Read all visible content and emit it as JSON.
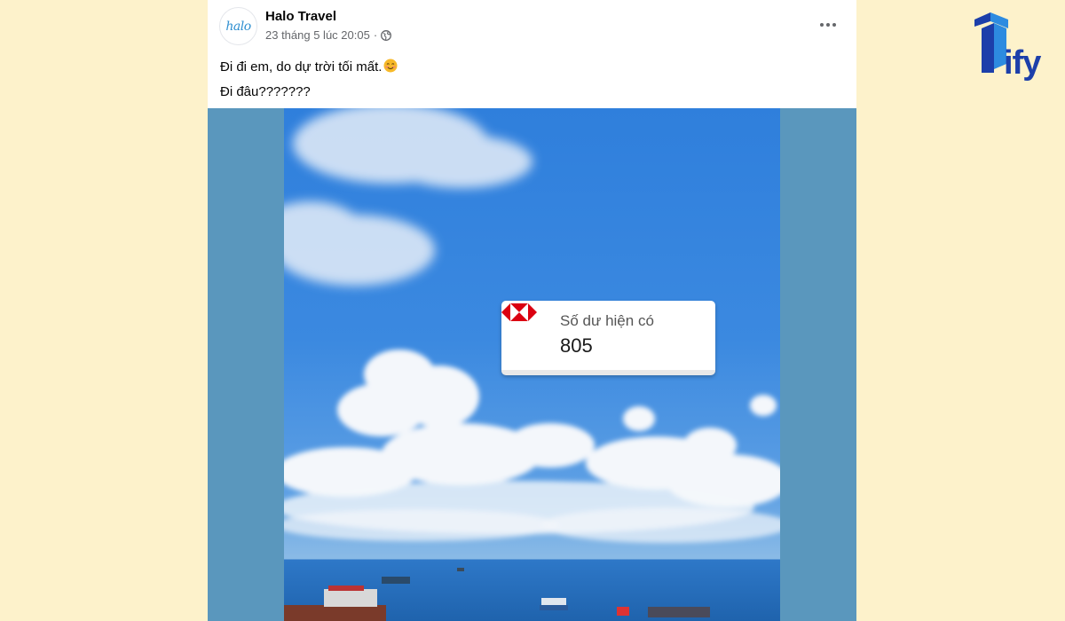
{
  "post": {
    "author": "Halo Travel",
    "avatar_text": "halo",
    "timestamp": "23 tháng 5 lúc 20:05",
    "separator": "·",
    "audience_icon": "globe-icon",
    "more_icon": "more-horizontal-icon",
    "lines": [
      "Đi đi em, do dự trời tối mất.",
      "Đi đâu???????"
    ],
    "emoji": "smiling-face-icon"
  },
  "overlay_card": {
    "label": "Số dư hiện có",
    "value": "805",
    "logo_icon": "bank-hexagon-logo-icon"
  },
  "brand": {
    "name": "ify",
    "logo_icon": "ify-logo-icon",
    "color": "#1c3faa"
  },
  "colors": {
    "background": "#fdf2cb",
    "media_backdrop": "#5a97bd",
    "bank_red": "#db0011"
  }
}
